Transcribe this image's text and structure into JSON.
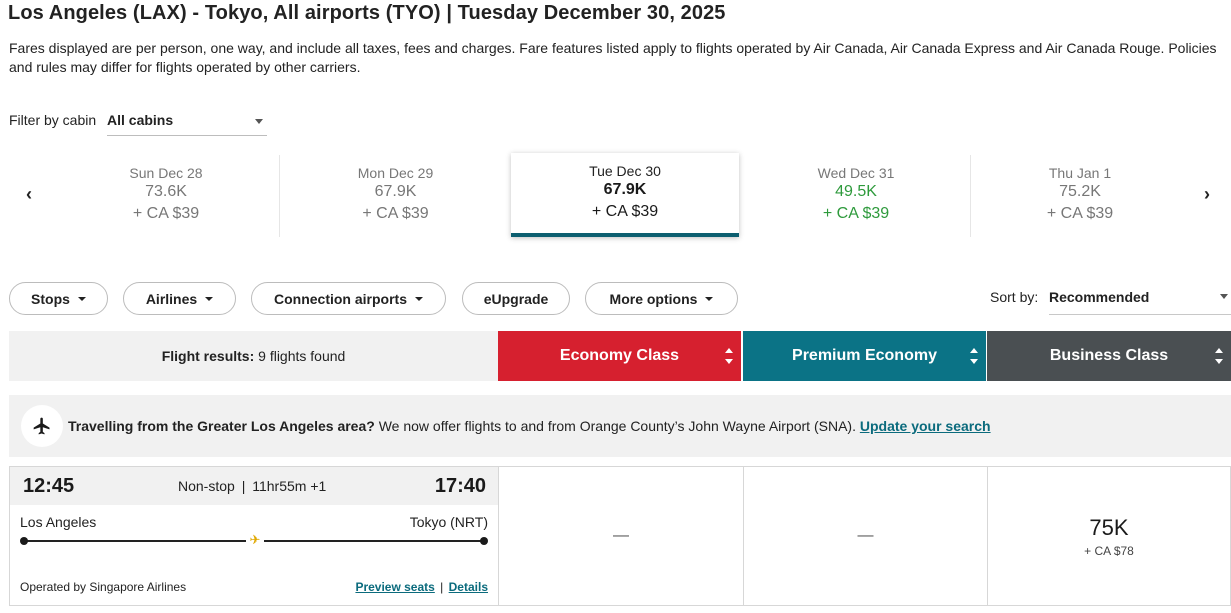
{
  "header": {
    "title": "Los Angeles (LAX) - Tokyo, All airports (TYO)  |  Tuesday December 30, 2025",
    "disclaimer": "Fares displayed are per person, one way, and include all taxes, fees and charges. Fare features listed apply to flights operated by Air Canada, Air Canada Express and Air Canada Rouge. Policies and rules may differ for flights operated by other carriers."
  },
  "filter": {
    "label": "Filter by cabin",
    "value": "All cabins"
  },
  "date_strip": {
    "prev_icon": "chevron-left-icon",
    "next_icon": "chevron-right-icon",
    "prev_glyph": "‹",
    "next_glyph": "›",
    "days": [
      {
        "date": "Sun Dec 28",
        "points": "73.6K",
        "taxes": "+ CA $39",
        "selected": false,
        "lowest": false
      },
      {
        "date": "Mon Dec 29",
        "points": "67.9K",
        "taxes": "+ CA $39",
        "selected": false,
        "lowest": false
      },
      {
        "date": "Tue Dec 30",
        "points": "67.9K",
        "taxes": "+ CA $39",
        "selected": true,
        "lowest": false
      },
      {
        "date": "Wed Dec 31",
        "points": "49.5K",
        "taxes": "+ CA $39",
        "selected": false,
        "lowest": true
      },
      {
        "date": "Thu Jan 1",
        "points": "75.2K",
        "taxes": "+ CA $39",
        "selected": false,
        "lowest": false
      }
    ]
  },
  "filters_bar": {
    "stops": "Stops",
    "airlines": "Airlines",
    "connection_airports": "Connection airports",
    "eupgrade": "eUpgrade",
    "more_options": "More options",
    "sort_label": "Sort by:",
    "sort_value": "Recommended"
  },
  "results_header": {
    "results_label": "Flight results:",
    "results_count": "9 flights found",
    "economy": "Economy Class",
    "premium": "Premium Economy",
    "business": "Business Class"
  },
  "notice": {
    "icon": "airplane-icon",
    "bold": "Travelling from the Greater Los Angeles area?",
    "text": " We now offer flights to and from Orange County’s John Wayne Airport (SNA). ",
    "link": "Update your search"
  },
  "flights": [
    {
      "depart_time": "12:45",
      "arrive_time": "17:40",
      "stops": "Non-stop",
      "separator": "|",
      "duration": "11hr55m",
      "day_offset": "+1",
      "origin": "Los Angeles",
      "destination": "Tokyo (NRT)",
      "operated_by": "Operated by Singapore Airlines",
      "preview_seats": "Preview seats",
      "link_sep": "|",
      "details": "Details",
      "economy": "—",
      "premium": "—",
      "business_points": "75K",
      "business_taxes": "+ CA $78"
    }
  ],
  "colors": {
    "economy": "#d6202f",
    "premium": "#0b7386",
    "business": "#4a4f52",
    "lowest_fare": "#2e9a3c",
    "selected_bar": "#0d5f70",
    "link": "#0b6b7d"
  }
}
